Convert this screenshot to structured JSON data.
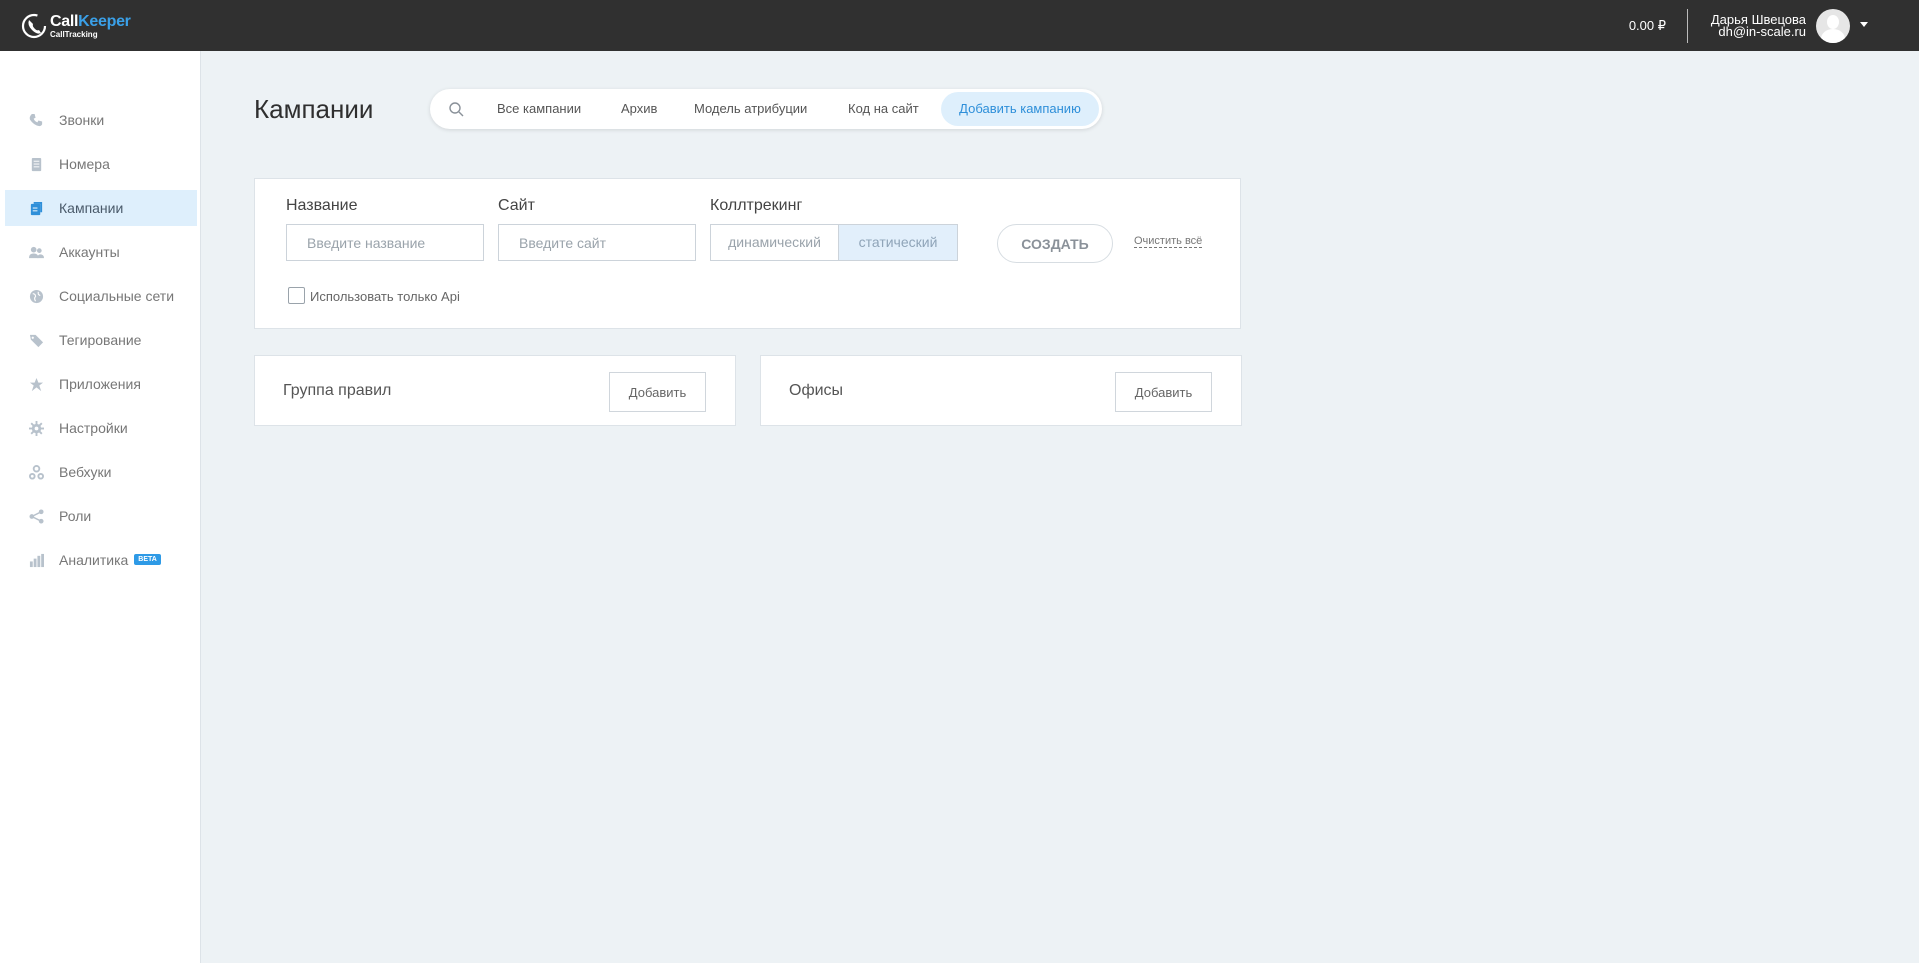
{
  "brand": {
    "name_part1": "Call",
    "name_part2": "Keeper",
    "subtitle": "CallTracking",
    "accent_color": "#3aa0e8"
  },
  "header": {
    "balance": "0.00 ₽",
    "user_name": "Дарья Швецова",
    "user_email": "dh@in-scale.ru"
  },
  "sidebar": {
    "items": [
      {
        "label": "Звонки",
        "icon": "phone-icon"
      },
      {
        "label": "Номера",
        "icon": "numbers-icon"
      },
      {
        "label": "Кампании",
        "icon": "campaign-icon",
        "active": true
      },
      {
        "label": "Аккаунты",
        "icon": "users-icon"
      },
      {
        "label": "Социальные сети",
        "icon": "globe-icon"
      },
      {
        "label": "Тегирование",
        "icon": "tags-icon"
      },
      {
        "label": "Приложения",
        "icon": "star-icon"
      },
      {
        "label": "Настройки",
        "icon": "gear-icon"
      },
      {
        "label": "Вебхуки",
        "icon": "webhook-icon"
      },
      {
        "label": "Роли",
        "icon": "share-icon"
      },
      {
        "label": "Аналитика",
        "icon": "bar-chart-icon",
        "badge": "BETA"
      }
    ]
  },
  "main": {
    "title": "Кампании",
    "tabs": [
      "Все кампании",
      "Архив",
      "Модель атрибуции",
      "Код на сайт"
    ],
    "active_tab": "Добавить кампанию"
  },
  "form": {
    "name_label": "Название",
    "name_placeholder": "Введите название",
    "site_label": "Сайт",
    "site_placeholder": "Введите сайт",
    "calltracking_label": "Коллтрекинг",
    "calltracking_options": [
      "динамический",
      "статический"
    ],
    "calltracking_selected": "статический",
    "create_label": "СОЗДАТЬ",
    "clear_label": "Очистить всё",
    "api_label": "Использовать только Api",
    "api_checked": false
  },
  "rule_groups": {
    "title": "Группа правил",
    "add_label": "Добавить"
  },
  "offices": {
    "title": "Офисы",
    "add_label": "Добавить"
  }
}
